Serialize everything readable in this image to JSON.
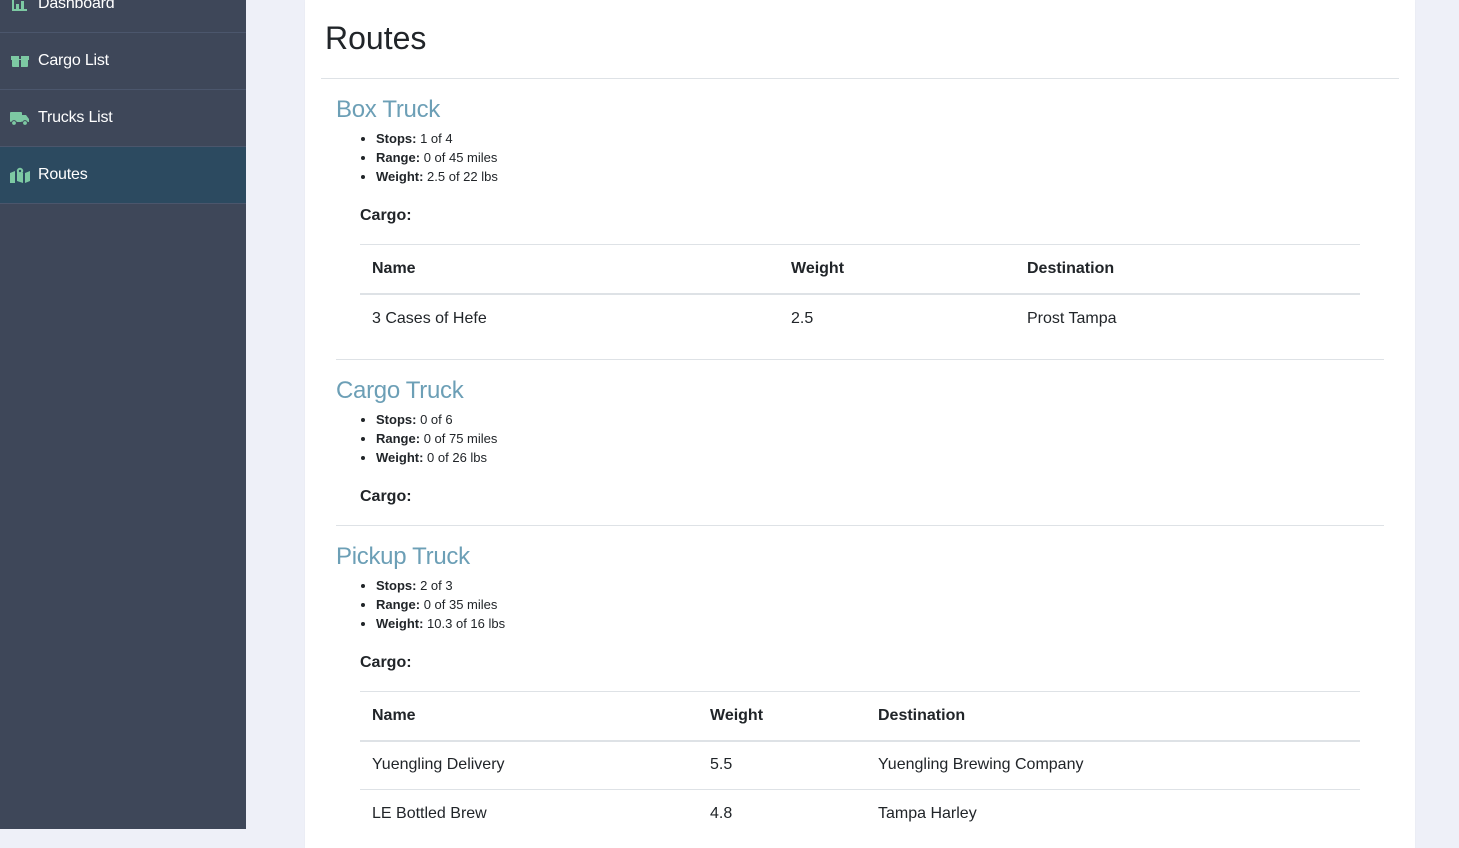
{
  "sidebar": {
    "items": [
      {
        "label": "Dashboard",
        "icon": "chart-icon"
      },
      {
        "label": "Cargo List",
        "icon": "boxes-icon"
      },
      {
        "label": "Trucks List",
        "icon": "truck-icon"
      },
      {
        "label": "Routes",
        "icon": "map-marked-icon",
        "active": true
      }
    ]
  },
  "page": {
    "title": "Routes"
  },
  "trucks": [
    {
      "name": "Box Truck",
      "stops_label": "Stops:",
      "stops": "1 of 4",
      "range_label": "Range:",
      "range": "0 of 45 miles",
      "weight_label": "Weight:",
      "weight": "2.5 of 22 lbs",
      "cargo_label": "Cargo:",
      "columns": [
        "Name",
        "Weight",
        "Destination"
      ],
      "rows": [
        {
          "name": "3 Cases of Hefe",
          "weight": "2.5",
          "destination": "Prost Tampa"
        }
      ]
    },
    {
      "name": "Cargo Truck",
      "stops_label": "Stops:",
      "stops": "0 of 6",
      "range_label": "Range:",
      "range": "0 of 75 miles",
      "weight_label": "Weight:",
      "weight": "0 of 26 lbs",
      "cargo_label": "Cargo:",
      "rows": []
    },
    {
      "name": "Pickup Truck",
      "stops_label": "Stops:",
      "stops": "2 of 3",
      "range_label": "Range:",
      "range": "0 of 35 miles",
      "weight_label": "Weight:",
      "weight": "10.3 of 16 lbs",
      "cargo_label": "Cargo:",
      "columns": [
        "Name",
        "Weight",
        "Destination"
      ],
      "rows": [
        {
          "name": "Yuengling Delivery",
          "weight": "5.5",
          "destination": "Yuengling Brewing Company"
        },
        {
          "name": "LE Bottled Brew",
          "weight": "4.8",
          "destination": "Tampa Harley"
        }
      ]
    }
  ],
  "colors": {
    "sidebar_bg": "#3e4759",
    "sidebar_active": "#2c4a60",
    "icon_green": "#7dc9a3",
    "truck_title": "#6c9fb6"
  }
}
